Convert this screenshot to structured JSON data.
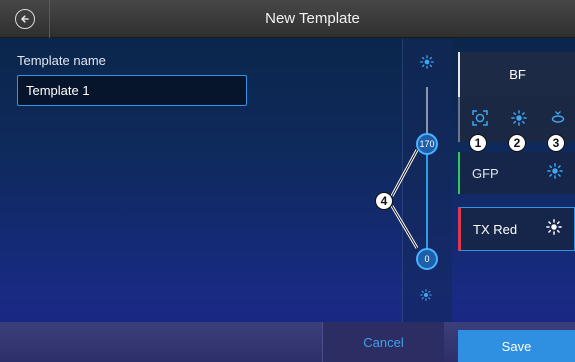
{
  "header": {
    "title": "New Template",
    "back_icon": "arrow-left-circle-icon"
  },
  "form": {
    "template_name_label": "Template name",
    "template_name_value": "Template 1"
  },
  "intensity_slider": {
    "icon": "light-sun-icon",
    "upper_value": "170",
    "lower_value": "0"
  },
  "channels": [
    {
      "name": "BF",
      "tools": [
        {
          "icon": "autofocus-frame-icon",
          "callout": "1"
        },
        {
          "icon": "light-sun-icon",
          "callout": "2"
        },
        {
          "icon": "focus-lens-icon",
          "callout": "3"
        }
      ]
    },
    {
      "name": "GFP",
      "icon": "light-sun-icon",
      "color": "#2ecc55"
    },
    {
      "name": "TX Red",
      "icon": "light-sun-icon",
      "color": "#e0384a",
      "selected": true
    }
  ],
  "callouts": {
    "slider": "4"
  },
  "footer": {
    "cancel_label": "Cancel",
    "save_label": "Save"
  },
  "colors": {
    "accent": "#2f96e6",
    "save": "#2f8fe0"
  }
}
